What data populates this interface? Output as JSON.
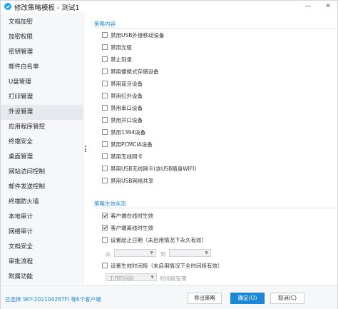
{
  "window": {
    "title": "修改策略模板 - 测试1",
    "icon": "app-logo-icon",
    "minimize_glyph": "—",
    "close_glyph": "✕"
  },
  "sidebar": {
    "items": [
      {
        "label": "文档加密"
      },
      {
        "label": "加密权限"
      },
      {
        "label": "密钥管理"
      },
      {
        "label": "邮件白名单"
      },
      {
        "label": "U盘管理"
      },
      {
        "label": "打印管理"
      },
      {
        "label": "外设管理",
        "active": true
      },
      {
        "label": "应用程序管控"
      },
      {
        "label": "终端安全"
      },
      {
        "label": "桌面管理"
      },
      {
        "label": "网站访问控制"
      },
      {
        "label": "邮件发送控制"
      },
      {
        "label": "终端防火墙"
      },
      {
        "label": "本地审计"
      },
      {
        "label": "网络审计"
      },
      {
        "label": "文档安全"
      },
      {
        "label": "审批流程"
      },
      {
        "label": "附属功能"
      }
    ]
  },
  "policy_content": {
    "title": "策略内容",
    "options": [
      {
        "label": "禁用USB外接移动设备",
        "checked": false
      },
      {
        "label": "禁用光驱",
        "checked": false
      },
      {
        "label": "禁止刻录",
        "checked": false
      },
      {
        "label": "禁用便携式存储设备",
        "checked": false
      },
      {
        "label": "禁用蓝牙设备",
        "checked": false
      },
      {
        "label": "禁用红外设备",
        "checked": false
      },
      {
        "label": "禁用串口设备",
        "checked": false
      },
      {
        "label": "禁用并口设备",
        "checked": false
      },
      {
        "label": "禁用1394设备",
        "checked": false
      },
      {
        "label": "禁用PCMCIA设备",
        "checked": false
      },
      {
        "label": "禁用无线网卡",
        "checked": false
      },
      {
        "label": "禁用USB无线网卡(含USB随身WIFI)",
        "checked": false
      },
      {
        "label": "禁用USB网络共享",
        "checked": false
      }
    ]
  },
  "policy_effect": {
    "title": "策略生效状态",
    "options": [
      {
        "label": "客户端在线时生效",
        "checked": true
      },
      {
        "label": "客户端离线时生效",
        "checked": true
      },
      {
        "label": "设置起止日期（未启用情况下永久有效）",
        "checked": false
      },
      {
        "label": "设置生效时间段（未启用情况下全时间段有效）",
        "checked": false
      }
    ],
    "from_label": "从",
    "to_label": "到",
    "from_value": "",
    "to_value": "",
    "period_value": "工作时间段",
    "period_manage_label": "时间段管理"
  },
  "footer": {
    "status": "已选择 SKY-20210426TFI 等6个客户端",
    "export_label": "导出策略",
    "ok_label": "确定(O)",
    "cancel_label": "取消(C)"
  },
  "colors": {
    "accent": "#1e88d6",
    "primary_button": "#1b87d5",
    "sidebar_bg": "#f6f7f9",
    "sidebar_active": "#e6eaef"
  }
}
